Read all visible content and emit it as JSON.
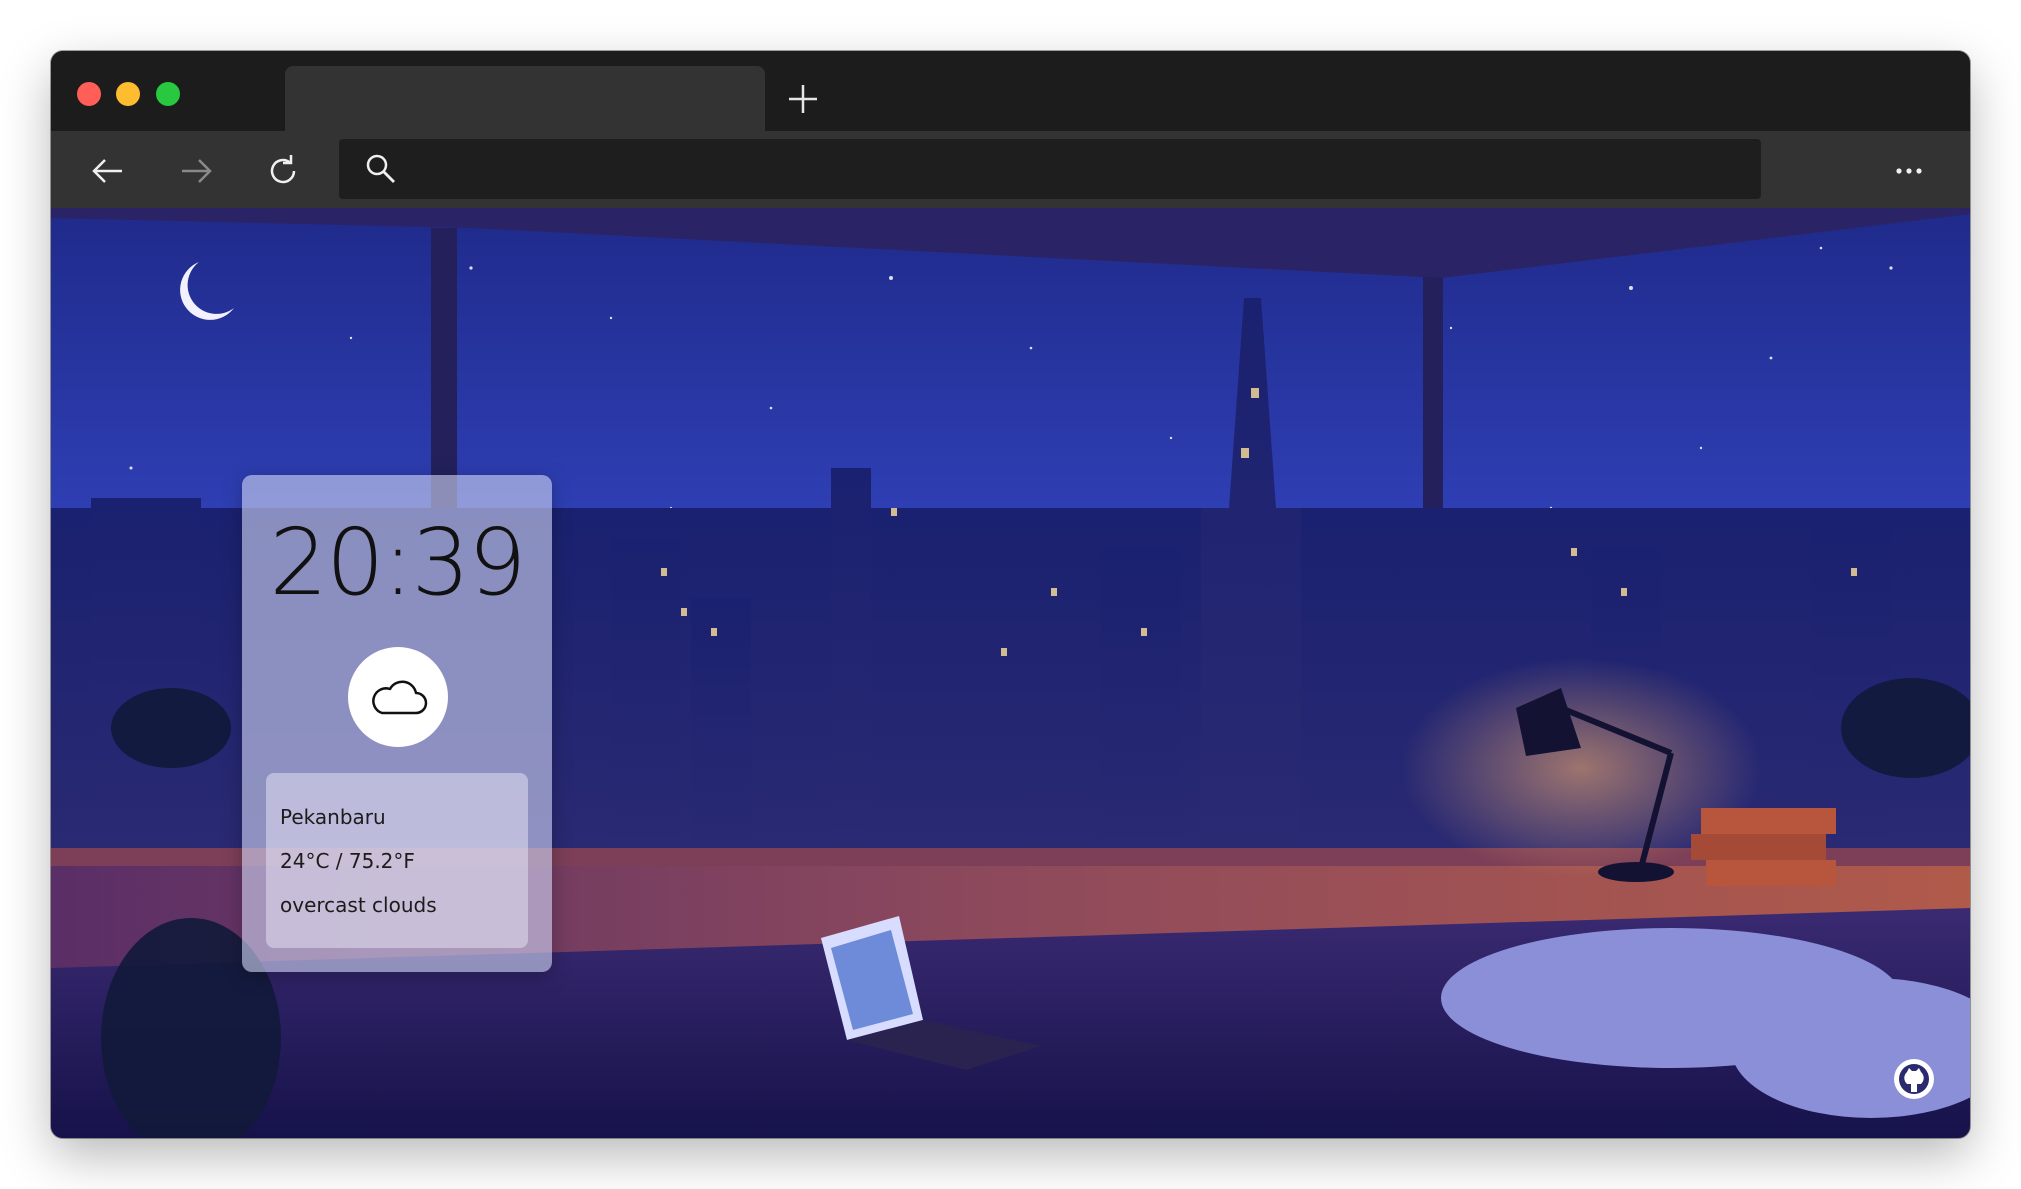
{
  "browser": {
    "tab_title": "",
    "url_text": "",
    "icons": {
      "back": "arrow-left-icon",
      "forward": "arrow-right-icon",
      "reload": "reload-icon",
      "search": "search-icon",
      "new_tab": "plus-icon",
      "menu": "more-horizontal-icon"
    },
    "colors": {
      "close": "#ff5f57",
      "minimize": "#febc2e",
      "maximize": "#28c840"
    }
  },
  "widget": {
    "time": "20:39",
    "weather_icon": "cloud-icon",
    "city": "Pekanbaru",
    "temperature": "24°C / 75.2°F",
    "condition": "overcast clouds"
  },
  "footer": {
    "link_icon": "github-icon"
  }
}
